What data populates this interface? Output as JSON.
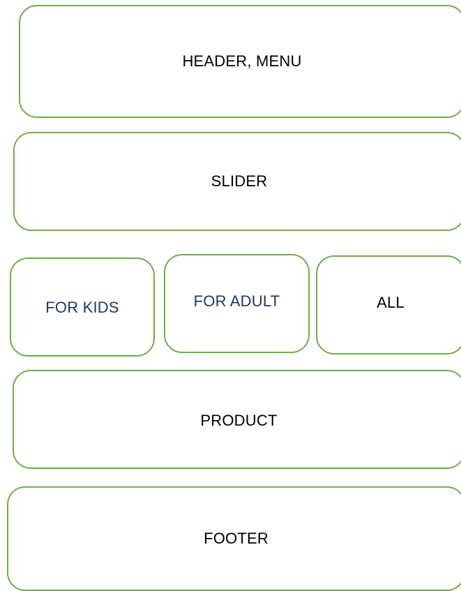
{
  "blocks": {
    "header": "HEADER, MENU",
    "slider": "SLIDER",
    "for_kids": "FOR KIDS",
    "for_adult": "FOR ADULT",
    "all": "ALL",
    "product": "PRODUCT",
    "footer": "FOOTER"
  },
  "colors": {
    "border": "#70ad47",
    "text": "#000000",
    "category_text": "#1f3864"
  }
}
